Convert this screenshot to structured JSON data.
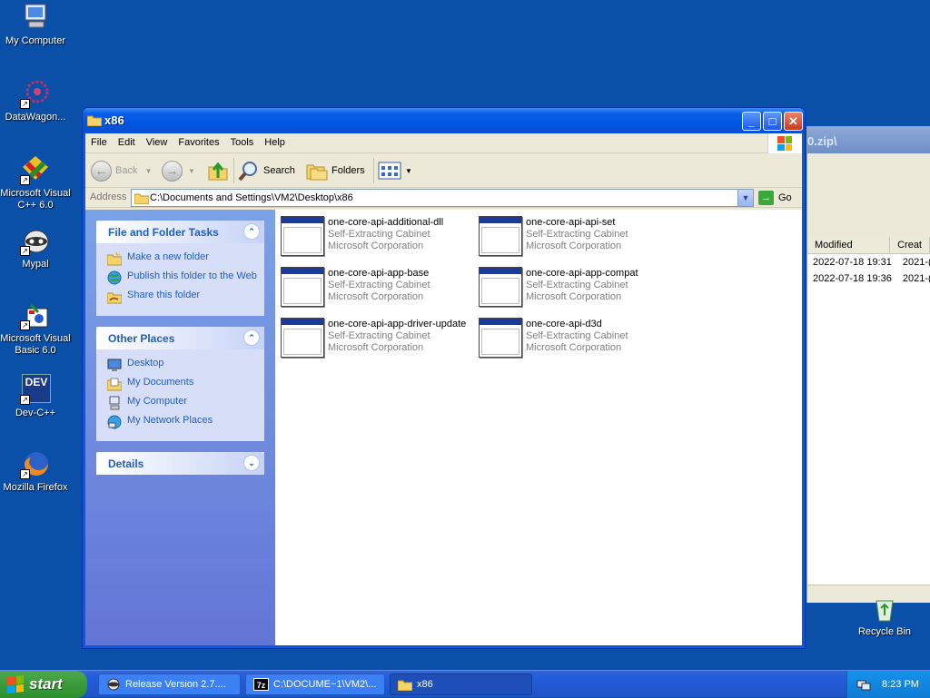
{
  "desktop": {
    "icons": [
      {
        "label": "My Computer",
        "icon": "my-computer-icon"
      },
      {
        "label": "DataWagon...",
        "icon": "datawagon-icon"
      },
      {
        "label": "Microsoft Visual C++ 6.0",
        "icon": "visual-cpp-icon"
      },
      {
        "label": "Mypal",
        "icon": "mypal-icon"
      },
      {
        "label": "Microsoft Visual Basic 6.0",
        "icon": "visual-basic-icon"
      },
      {
        "label": "Dev-C++",
        "icon": "devcpp-icon"
      },
      {
        "label": "Mozilla Firefox",
        "icon": "firefox-icon"
      }
    ],
    "dev_badge": "DEV",
    "recycle_bin": "Recycle Bin"
  },
  "background_window": {
    "title_fragment": "0.zip\\",
    "columns": [
      "Modified",
      "Creat"
    ],
    "rows": [
      [
        "2022-07-18 19:31",
        "2021-("
      ],
      [
        "2022-07-18 19:36",
        "2021-("
      ]
    ]
  },
  "window": {
    "title": "x86",
    "menu": [
      "File",
      "Edit",
      "View",
      "Favorites",
      "Tools",
      "Help"
    ],
    "toolbar": {
      "back": "Back",
      "search": "Search",
      "folders": "Folders"
    },
    "address": {
      "label": "Address",
      "path": "C:\\Documents and Settings\\VM2\\Desktop\\x86",
      "go": "Go"
    },
    "task_pane": {
      "file_tasks": {
        "title": "File and Folder Tasks",
        "items": [
          "Make a new folder",
          "Publish this folder to the Web",
          "Share this folder"
        ]
      },
      "other_places": {
        "title": "Other Places",
        "items": [
          "Desktop",
          "My Documents",
          "My Computer",
          "My Network Places"
        ]
      },
      "details": {
        "title": "Details"
      }
    },
    "files": [
      {
        "name": "one-core-api-additional-dll",
        "type": "Self-Extracting Cabinet",
        "company": "Microsoft Corporation"
      },
      {
        "name": "one-core-api-api-set",
        "type": "Self-Extracting Cabinet",
        "company": "Microsoft Corporation"
      },
      {
        "name": "one-core-api-app-base",
        "type": "Self-Extracting Cabinet",
        "company": "Microsoft Corporation"
      },
      {
        "name": "one-core-api-app-compat",
        "type": "Self-Extracting Cabinet",
        "company": "Microsoft Corporation"
      },
      {
        "name": "one-core-api-app-driver-update",
        "type": "Self-Extracting Cabinet",
        "company": "Microsoft Corporation"
      },
      {
        "name": "one-core-api-d3d",
        "type": "Self-Extracting Cabinet",
        "company": "Microsoft Corporation"
      }
    ]
  },
  "taskbar": {
    "start": "start",
    "buttons": [
      "Release Version 2.7....",
      "C:\\DOCUME~1\\VM2\\...",
      "x86"
    ],
    "seven_zip_badge": "7z",
    "clock": "8:23 PM"
  },
  "colors": {
    "desktop": "#0a4fa8",
    "title_blue": "#0054e3",
    "task_link": "#215dc6",
    "start_green": "#3a9b3a"
  }
}
